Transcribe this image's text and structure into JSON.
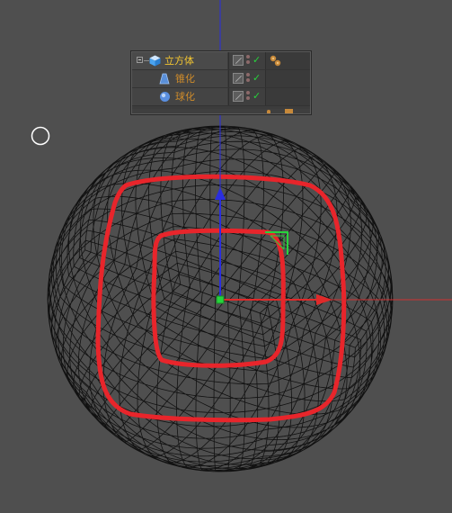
{
  "object_manager": {
    "objects": [
      {
        "name": "立方体",
        "type": "cube",
        "color": "#f2c531",
        "level": 0,
        "selected": true
      },
      {
        "name": "锥化",
        "type": "taper-deformer",
        "color": "#d08c2a",
        "level": 1
      },
      {
        "name": "球化",
        "type": "spherify-deformer",
        "color": "#d08c2a",
        "level": 1
      }
    ],
    "check_mark": "✓"
  },
  "viewport": {
    "background": "#4f4f4f",
    "wireframe_color": "#111111",
    "highlight_color": "#e8252b",
    "axis_colors": {
      "y": "#2a2ee0",
      "x": "#e02a2a",
      "origin": "#27d33c"
    }
  }
}
